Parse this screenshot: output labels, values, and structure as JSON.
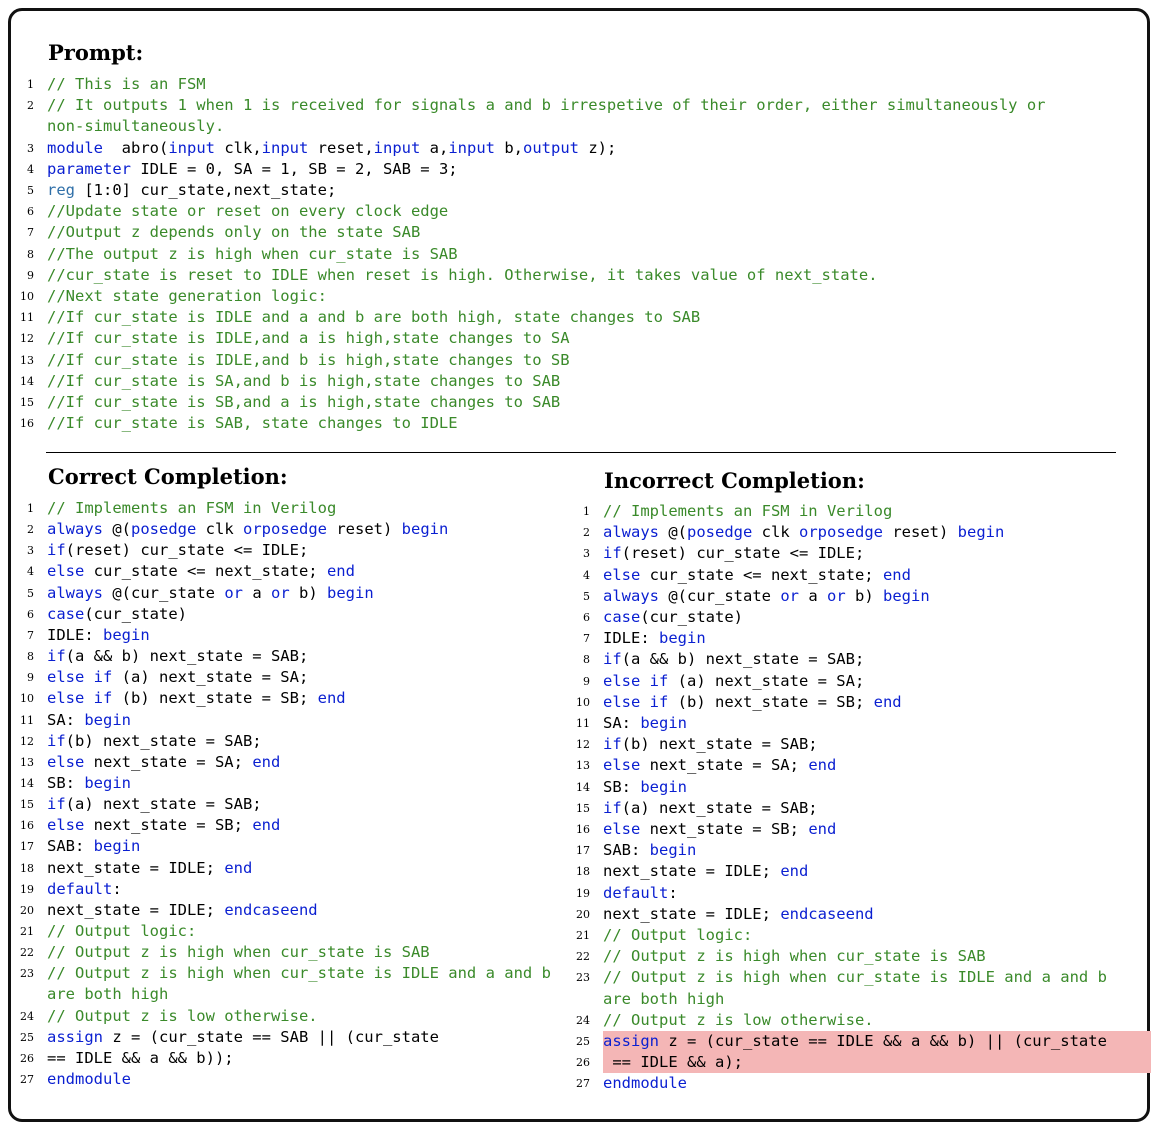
{
  "prompt": {
    "heading": "Prompt:",
    "lines": [
      {
        "n": "1",
        "parts": [
          [
            "cm",
            "// This is an FSM"
          ]
        ]
      },
      {
        "n": "2",
        "parts": [
          [
            "cm",
            "// It outputs 1 when 1 is received for signals a and b irrespetive of their order, either simultaneously or"
          ]
        ]
      },
      {
        "n": "",
        "parts": [
          [
            "cm",
            "non-simultaneously."
          ]
        ]
      },
      {
        "n": "3",
        "parts": [
          [
            "kw",
            "module"
          ],
          [
            "",
            "  abro("
          ],
          [
            "kw",
            "input"
          ],
          [
            "",
            " clk,"
          ],
          [
            "kw",
            "input"
          ],
          [
            "",
            " reset,"
          ],
          [
            "kw",
            "input"
          ],
          [
            "",
            " a,"
          ],
          [
            "kw",
            "input"
          ],
          [
            "",
            " b,"
          ],
          [
            "kw",
            "output"
          ],
          [
            "",
            " z);"
          ]
        ]
      },
      {
        "n": "4",
        "parts": [
          [
            "kw",
            "parameter"
          ],
          [
            "",
            " IDLE = 0, SA = 1, SB = 2, SAB = 3;"
          ]
        ]
      },
      {
        "n": "5",
        "parts": [
          [
            "typ",
            "reg"
          ],
          [
            "",
            " [1:0] cur_state,next_state;"
          ]
        ]
      },
      {
        "n": "6",
        "parts": [
          [
            "cm",
            "//Update state or reset on every clock edge"
          ]
        ]
      },
      {
        "n": "7",
        "parts": [
          [
            "cm",
            "//Output z depends only on the state SAB"
          ]
        ]
      },
      {
        "n": "8",
        "parts": [
          [
            "cm",
            "//The output z is high when cur_state is SAB"
          ]
        ]
      },
      {
        "n": "9",
        "parts": [
          [
            "cm",
            "//cur_state is reset to IDLE when reset is high. Otherwise, it takes value of next_state."
          ]
        ]
      },
      {
        "n": "10",
        "parts": [
          [
            "cm",
            "//Next state generation logic:"
          ]
        ]
      },
      {
        "n": "11",
        "parts": [
          [
            "cm",
            "//If cur_state is IDLE and a and b are both high, state changes to SAB"
          ]
        ]
      },
      {
        "n": "12",
        "parts": [
          [
            "cm",
            "//If cur_state is IDLE,and a is high,state changes to SA"
          ]
        ]
      },
      {
        "n": "13",
        "parts": [
          [
            "cm",
            "//If cur_state is IDLE,and b is high,state changes to SB"
          ]
        ]
      },
      {
        "n": "14",
        "parts": [
          [
            "cm",
            "//If cur_state is SA,and b is high,state changes to SAB"
          ]
        ]
      },
      {
        "n": "15",
        "parts": [
          [
            "cm",
            "//If cur_state is SB,and a is high,state changes to SAB"
          ]
        ]
      },
      {
        "n": "16",
        "parts": [
          [
            "cm",
            "//If cur_state is SAB, state changes to IDLE"
          ]
        ]
      }
    ]
  },
  "correct": {
    "heading": "Correct Completion:",
    "lines": [
      {
        "n": "1",
        "parts": [
          [
            "cm",
            "// Implements an FSM in Verilog"
          ]
        ]
      },
      {
        "n": "2",
        "parts": [
          [
            "kw",
            "always"
          ],
          [
            "",
            " @("
          ],
          [
            "kw",
            "posedge"
          ],
          [
            "",
            " clk "
          ],
          [
            "kw",
            "or"
          ],
          [
            " ",
            ""
          ],
          [
            "kw",
            "posedge"
          ],
          [
            "",
            " reset) "
          ],
          [
            "kw",
            "begin"
          ]
        ]
      },
      {
        "n": "3",
        "parts": [
          [
            "kw",
            "if"
          ],
          [
            "",
            "(reset) cur_state <= IDLE;"
          ]
        ]
      },
      {
        "n": "4",
        "parts": [
          [
            "kw",
            "else"
          ],
          [
            "",
            " cur_state <= next_state; "
          ],
          [
            "kw",
            "end"
          ]
        ]
      },
      {
        "n": "5",
        "parts": [
          [
            "kw",
            "always"
          ],
          [
            "",
            " @(cur_state "
          ],
          [
            "kw",
            "or"
          ],
          [
            "",
            " a "
          ],
          [
            "kw",
            "or"
          ],
          [
            "",
            " b) "
          ],
          [
            "kw",
            "begin"
          ]
        ]
      },
      {
        "n": "6",
        "parts": [
          [
            "kw",
            "case"
          ],
          [
            "",
            "(cur_state)"
          ]
        ]
      },
      {
        "n": "7",
        "parts": [
          [
            "",
            "IDLE: "
          ],
          [
            "kw",
            "begin"
          ]
        ]
      },
      {
        "n": "8",
        "parts": [
          [
            "kw",
            "if"
          ],
          [
            "",
            "(a && b) next_state = SAB;"
          ]
        ]
      },
      {
        "n": "9",
        "parts": [
          [
            "kw",
            "else if"
          ],
          [
            "",
            " (a) next_state = SA;"
          ]
        ]
      },
      {
        "n": "10",
        "parts": [
          [
            "kw",
            "else if"
          ],
          [
            "",
            " (b) next_state = SB; "
          ],
          [
            "kw",
            "end"
          ]
        ]
      },
      {
        "n": "11",
        "parts": [
          [
            "",
            "SA: "
          ],
          [
            "kw",
            "begin"
          ]
        ]
      },
      {
        "n": "12",
        "parts": [
          [
            "kw",
            "if"
          ],
          [
            "",
            "(b) next_state = SAB;"
          ]
        ]
      },
      {
        "n": "13",
        "parts": [
          [
            "kw",
            "else"
          ],
          [
            "",
            " next_state = SA; "
          ],
          [
            "kw",
            "end"
          ]
        ]
      },
      {
        "n": "14",
        "parts": [
          [
            "",
            "SB: "
          ],
          [
            "kw",
            "begin"
          ]
        ]
      },
      {
        "n": "15",
        "parts": [
          [
            "kw",
            "if"
          ],
          [
            "",
            "(a) next_state = SAB;"
          ]
        ]
      },
      {
        "n": "16",
        "parts": [
          [
            "kw",
            "else"
          ],
          [
            "",
            " next_state = SB; "
          ],
          [
            "kw",
            "end"
          ]
        ]
      },
      {
        "n": "17",
        "parts": [
          [
            "",
            "SAB: "
          ],
          [
            "kw",
            "begin"
          ]
        ]
      },
      {
        "n": "18",
        "parts": [
          [
            "",
            "next_state = IDLE; "
          ],
          [
            "kw",
            "end"
          ]
        ]
      },
      {
        "n": "19",
        "parts": [
          [
            "kw",
            "default"
          ],
          [
            "",
            ":"
          ]
        ]
      },
      {
        "n": "20",
        "parts": [
          [
            "",
            "next_state = IDLE; "
          ],
          [
            "kw",
            "endcase"
          ],
          [
            " ",
            ""
          ],
          [
            "kw",
            "end"
          ]
        ]
      },
      {
        "n": "21",
        "parts": [
          [
            "cm",
            "// Output logic:"
          ]
        ]
      },
      {
        "n": "22",
        "parts": [
          [
            "cm",
            "// Output z is high when cur_state is SAB"
          ]
        ]
      },
      {
        "n": "23",
        "parts": [
          [
            "cm",
            "// Output z is high when cur_state is IDLE and a and b"
          ]
        ]
      },
      {
        "n": "",
        "parts": [
          [
            "cm",
            "are both high"
          ]
        ]
      },
      {
        "n": "24",
        "parts": [
          [
            "cm",
            "// Output z is low otherwise."
          ]
        ]
      },
      {
        "n": "25",
        "parts": [
          [
            "kw",
            "assign"
          ],
          [
            "",
            " z = (cur_state == SAB || (cur_state"
          ]
        ]
      },
      {
        "n": "26",
        "parts": [
          [
            "",
            "== IDLE && a && b));"
          ]
        ]
      },
      {
        "n": "27",
        "parts": [
          [
            "kw",
            "endmodule"
          ]
        ]
      }
    ]
  },
  "incorrect": {
    "heading": "Incorrect Completion:",
    "lines": [
      {
        "n": "1",
        "parts": [
          [
            "cm",
            "// Implements an FSM in Verilog"
          ]
        ]
      },
      {
        "n": "2",
        "parts": [
          [
            "kw",
            "always"
          ],
          [
            "",
            " @("
          ],
          [
            "kw",
            "posedge"
          ],
          [
            "",
            " clk "
          ],
          [
            "kw",
            "or"
          ],
          [
            " ",
            ""
          ],
          [
            "kw",
            "posedge"
          ],
          [
            "",
            " reset) "
          ],
          [
            "kw",
            "begin"
          ]
        ]
      },
      {
        "n": "3",
        "parts": [
          [
            "kw",
            "if"
          ],
          [
            "",
            "(reset) cur_state <= IDLE;"
          ]
        ]
      },
      {
        "n": "4",
        "parts": [
          [
            "kw",
            "else"
          ],
          [
            "",
            " cur_state <= next_state; "
          ],
          [
            "kw",
            "end"
          ]
        ]
      },
      {
        "n": "5",
        "parts": [
          [
            "kw",
            "always"
          ],
          [
            "",
            " @(cur_state "
          ],
          [
            "kw",
            "or"
          ],
          [
            "",
            " a "
          ],
          [
            "kw",
            "or"
          ],
          [
            "",
            " b) "
          ],
          [
            "kw",
            "begin"
          ]
        ]
      },
      {
        "n": "6",
        "parts": [
          [
            "kw",
            "case"
          ],
          [
            "",
            "(cur_state)"
          ]
        ]
      },
      {
        "n": "7",
        "parts": [
          [
            "",
            "IDLE: "
          ],
          [
            "kw",
            "begin"
          ]
        ]
      },
      {
        "n": "8",
        "parts": [
          [
            "kw",
            "if"
          ],
          [
            "",
            "(a && b) next_state = SAB;"
          ]
        ]
      },
      {
        "n": "9",
        "parts": [
          [
            "kw",
            "else if"
          ],
          [
            "",
            " (a) next_state = SA;"
          ]
        ]
      },
      {
        "n": "10",
        "parts": [
          [
            "kw",
            "else if"
          ],
          [
            "",
            " (b) next_state = SB; "
          ],
          [
            "kw",
            "end"
          ]
        ]
      },
      {
        "n": "11",
        "parts": [
          [
            "",
            "SA: "
          ],
          [
            "kw",
            "begin"
          ]
        ]
      },
      {
        "n": "12",
        "parts": [
          [
            "kw",
            "if"
          ],
          [
            "",
            "(b) next_state = SAB;"
          ]
        ]
      },
      {
        "n": "13",
        "parts": [
          [
            "kw",
            "else"
          ],
          [
            "",
            " next_state = SA; "
          ],
          [
            "kw",
            "end"
          ]
        ]
      },
      {
        "n": "14",
        "parts": [
          [
            "",
            "SB: "
          ],
          [
            "kw",
            "begin"
          ]
        ]
      },
      {
        "n": "15",
        "parts": [
          [
            "kw",
            "if"
          ],
          [
            "",
            "(a) next_state = SAB;"
          ]
        ]
      },
      {
        "n": "16",
        "parts": [
          [
            "kw",
            "else"
          ],
          [
            "",
            " next_state = SB; "
          ],
          [
            "kw",
            "end"
          ]
        ]
      },
      {
        "n": "17",
        "parts": [
          [
            "",
            "SAB: "
          ],
          [
            "kw",
            "begin"
          ]
        ]
      },
      {
        "n": "18",
        "parts": [
          [
            "",
            "next_state = IDLE; "
          ],
          [
            "kw",
            "end"
          ]
        ]
      },
      {
        "n": "19",
        "parts": [
          [
            "kw",
            "default"
          ],
          [
            "",
            ":"
          ]
        ]
      },
      {
        "n": "20",
        "parts": [
          [
            "",
            "next_state = IDLE; "
          ],
          [
            "kw",
            "endcase"
          ],
          [
            " ",
            ""
          ],
          [
            "kw",
            "end"
          ]
        ]
      },
      {
        "n": "21",
        "parts": [
          [
            "cm",
            "// Output logic:"
          ]
        ]
      },
      {
        "n": "22",
        "parts": [
          [
            "cm",
            "// Output z is high when cur_state is SAB"
          ]
        ]
      },
      {
        "n": "23",
        "parts": [
          [
            "cm",
            "// Output z is high when cur_state is IDLE and a and b"
          ]
        ]
      },
      {
        "n": "",
        "parts": [
          [
            "cm",
            "are both high"
          ]
        ]
      },
      {
        "n": "24",
        "parts": [
          [
            "cm",
            "// Output z is low otherwise."
          ]
        ]
      },
      {
        "n": "25",
        "hl": true,
        "parts": [
          [
            "kw",
            "assign"
          ],
          [
            "",
            " z = (cur_state == IDLE && a && b) || (cur_state"
          ]
        ]
      },
      {
        "n": "26",
        "hl": true,
        "parts": [
          [
            "",
            " == IDLE && a);"
          ]
        ]
      },
      {
        "n": "27",
        "parts": [
          [
            "kw",
            "endmodule"
          ]
        ]
      }
    ]
  },
  "colors": {
    "keyword": "#0a1fd1",
    "type": "#2f6fa8",
    "comment": "#3a8a2a",
    "highlight": "#f4b6b6"
  }
}
